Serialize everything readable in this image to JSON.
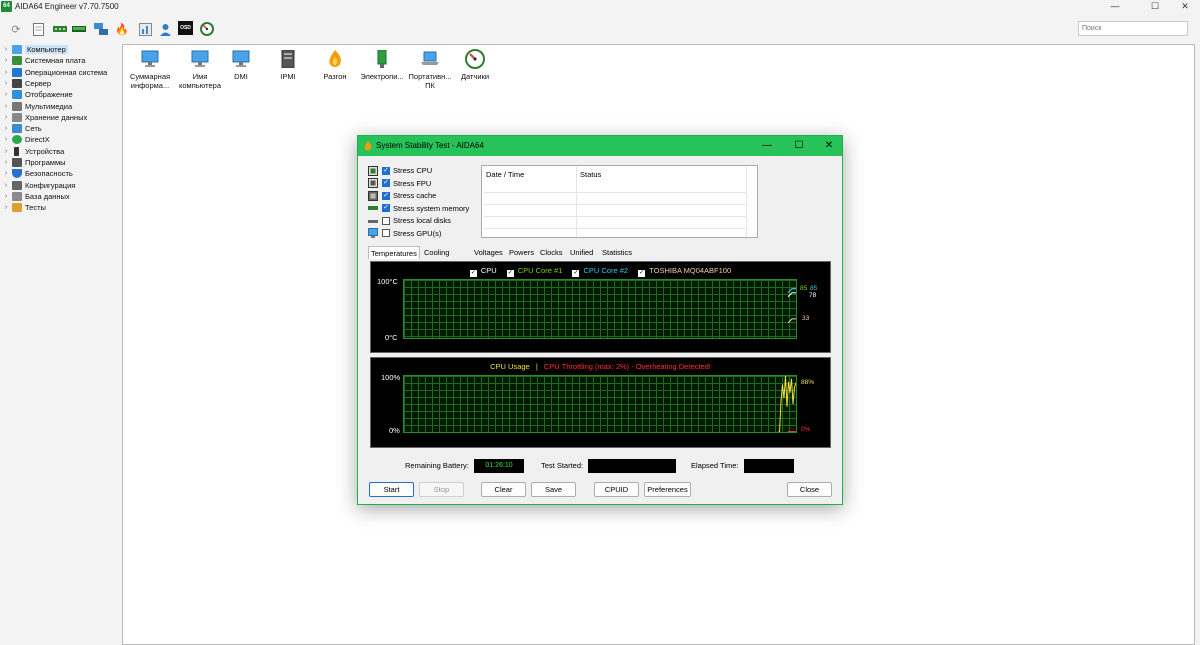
{
  "app": {
    "logo_text": "64",
    "title": "AIDA64 Engineer v7.70.7500",
    "controls": {
      "minimize": "—",
      "maximize": "☐",
      "close": "✕"
    }
  },
  "toolbar": {
    "icons": [
      "refresh-icon",
      "report-icon",
      "memory-icon",
      "ram-module-icon",
      "network-icon",
      "flame-icon",
      "benchmark-icon",
      "user-icon",
      "osd-icon",
      "gauge-icon"
    ],
    "osd_label": "OSD",
    "search_placeholder": "Поиск"
  },
  "tree": {
    "items": [
      {
        "label": "Компьютер",
        "icon": "computer-icon",
        "color": "#4aa3e8",
        "selected": true
      },
      {
        "label": "Системная плата",
        "icon": "motherboard-icon",
        "color": "#3a8f3a"
      },
      {
        "label": "Операционная система",
        "icon": "windows-icon",
        "color": "#1f78d1"
      },
      {
        "label": "Сервер",
        "icon": "server-icon",
        "color": "#444444"
      },
      {
        "label": "Отображение",
        "icon": "display-icon",
        "color": "#2f8fd8"
      },
      {
        "label": "Мультимедиа",
        "icon": "multimedia-icon",
        "color": "#777777"
      },
      {
        "label": "Хранение данных",
        "icon": "storage-icon",
        "color": "#888888"
      },
      {
        "label": "Сеть",
        "icon": "network-icon",
        "color": "#3b8bd0"
      },
      {
        "label": "DirectX",
        "icon": "directx-icon",
        "color": "#2aa84a"
      },
      {
        "label": "Устройства",
        "icon": "devices-icon",
        "color": "#333333"
      },
      {
        "label": "Программы",
        "icon": "programs-icon",
        "color": "#555555"
      },
      {
        "label": "Безопасность",
        "icon": "security-icon",
        "color": "#2a6fc9"
      },
      {
        "label": "Конфигурация",
        "icon": "configuration-icon",
        "color": "#666666"
      },
      {
        "label": "База данных",
        "icon": "database-icon",
        "color": "#8a8a8a"
      },
      {
        "label": "Тесты",
        "icon": "tests-icon",
        "color": "#e0a030"
      }
    ]
  },
  "content": {
    "categories": [
      {
        "label": "Суммарная информа...",
        "icon": "summary-computer-icon"
      },
      {
        "label": "Имя компьютера",
        "icon": "computer-name-icon"
      },
      {
        "label": "DMI",
        "icon": "dmi-icon"
      },
      {
        "label": "IPMI",
        "icon": "ipmi-icon"
      },
      {
        "label": "Разгон",
        "icon": "overclock-flame-icon"
      },
      {
        "label": "Электропи...",
        "icon": "power-icon"
      },
      {
        "label": "Портативн... ПК",
        "icon": "portable-pc-icon"
      },
      {
        "label": "Датчики",
        "icon": "sensor-gauge-icon"
      }
    ]
  },
  "dialog": {
    "title": "System Stability Test - AIDA64",
    "stress": [
      {
        "label": "Stress CPU",
        "checked": true
      },
      {
        "label": "Stress FPU",
        "checked": true
      },
      {
        "label": "Stress cache",
        "checked": true
      },
      {
        "label": "Stress system memory",
        "checked": true
      },
      {
        "label": "Stress local disks",
        "checked": false
      },
      {
        "label": "Stress GPU(s)",
        "checked": false
      }
    ],
    "log_columns": [
      "Date / Time",
      "Status"
    ],
    "tabs": [
      "Temperatures",
      "Cooling Fans",
      "Voltages",
      "Powers",
      "Clocks",
      "Unified",
      "Statistics"
    ],
    "active_tab": "Temperatures",
    "temp_graph": {
      "legend": [
        {
          "label": "CPU",
          "color": "#ffffff",
          "checked": true
        },
        {
          "label": "CPU Core #1",
          "color": "#7bd400",
          "checked": true
        },
        {
          "label": "CPU Core #2",
          "color": "#36c6f0",
          "checked": true
        },
        {
          "label": "TOSHIBA MQ04ABF100",
          "color": "#f0d2a0",
          "checked": true
        }
      ],
      "y_max_label": "100°C",
      "y_min_label": "0°C",
      "y_range": [
        0,
        100
      ],
      "values": [
        {
          "text": "85",
          "value": 85,
          "color": "#7bd400"
        },
        {
          "text": "85",
          "value": 85,
          "color": "#36c6f0"
        },
        {
          "text": "78",
          "value": 78,
          "color": "#ffffff"
        },
        {
          "text": "33",
          "value": 33,
          "color": "#f0d2a0"
        }
      ]
    },
    "usage_graph": {
      "title_usage": "CPU Usage",
      "separator": "|",
      "title_throttle": "CPU Throttling (max: 2%) - Overheating Detected!",
      "usage_color": "#f0e040",
      "throttle_color": "#ff3030",
      "y_max_label": "100%",
      "y_min_label": "0%",
      "usage_value": "88%",
      "usage_pct": 88,
      "throttle_value": "0%",
      "throttle_pct": 0,
      "usage_history": [
        0.0,
        0.0,
        0.55,
        0.85,
        0.6,
        1.0,
        0.45,
        0.9,
        0.7,
        0.95,
        0.5,
        0.8,
        0.88
      ]
    },
    "info": {
      "battery_label": "Remaining Battery:",
      "battery_value": "01:26:10",
      "started_label": "Test Started:",
      "started_value": "",
      "elapsed_label": "Elapsed Time:",
      "elapsed_value": ""
    },
    "buttons": {
      "start": "Start",
      "stop": "Stop",
      "clear": "Clear",
      "save": "Save",
      "cpuid": "CPUID",
      "preferences": "Preferences",
      "close": "Close"
    }
  }
}
